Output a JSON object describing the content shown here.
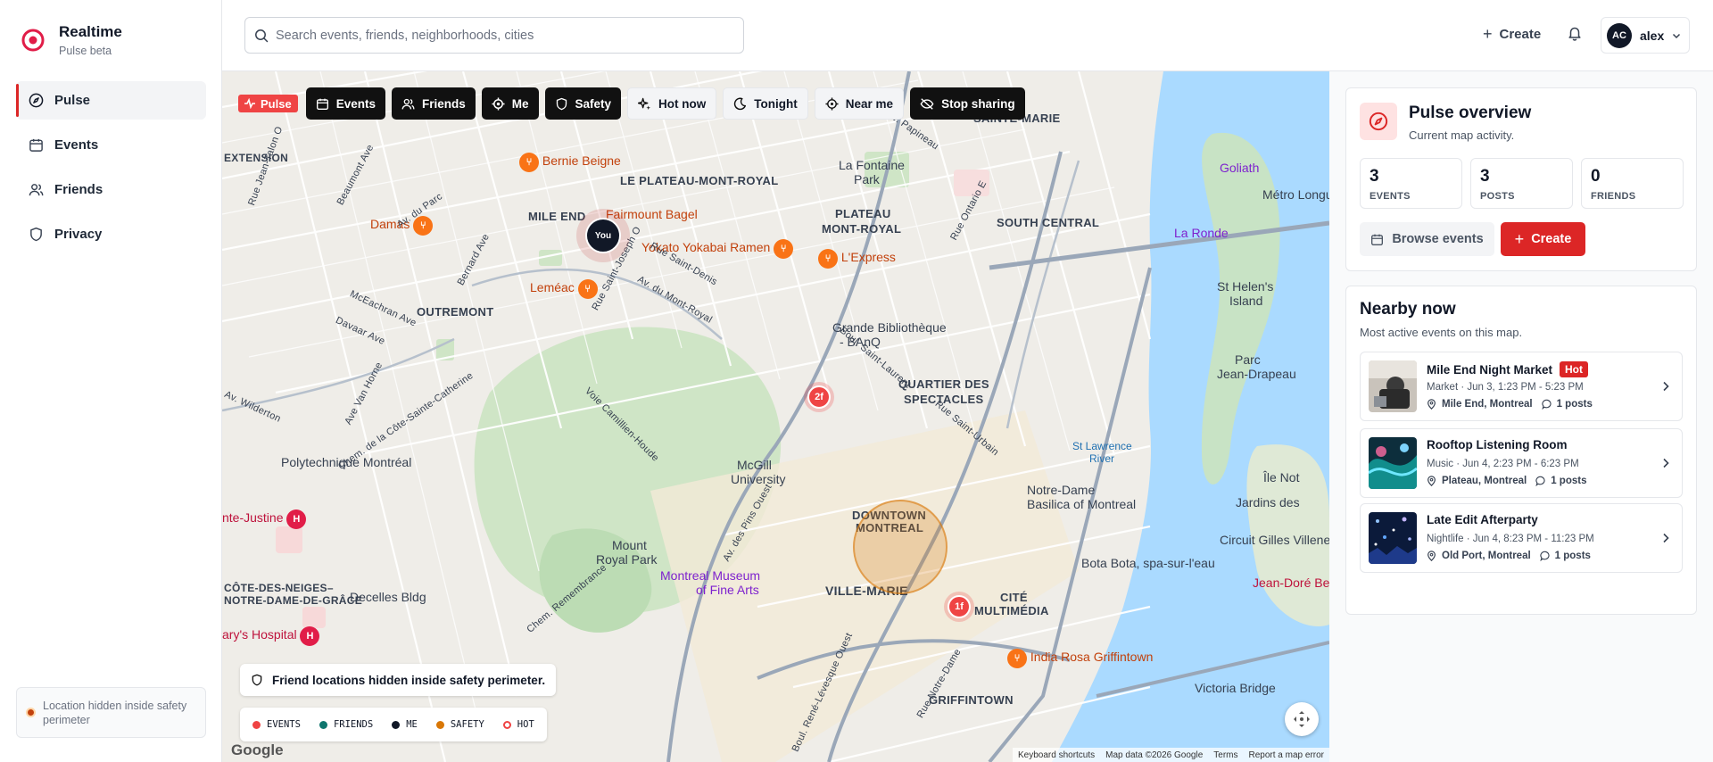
{
  "brand": {
    "name": "Realtime",
    "subtitle": "Pulse beta"
  },
  "sidebar": {
    "items": [
      {
        "label": "Pulse",
        "icon": "compass-icon",
        "active": true
      },
      {
        "label": "Events",
        "icon": "calendar-icon",
        "active": false
      },
      {
        "label": "Friends",
        "icon": "users-icon",
        "active": false
      },
      {
        "label": "Privacy",
        "icon": "shield-icon",
        "active": false
      }
    ],
    "footer": "Location hidden inside safety perimeter"
  },
  "header": {
    "search_placeholder": "Search events, friends, neighborhoods, cities",
    "create_label": "Create",
    "user": {
      "initials": "AC",
      "name": "alex"
    }
  },
  "map": {
    "pulse_badge": "Pulse",
    "filters": [
      {
        "label": "Events",
        "icon": "calendar-icon",
        "style": "dark"
      },
      {
        "label": "Friends",
        "icon": "users-icon",
        "style": "dark"
      },
      {
        "label": "Me",
        "icon": "target-icon",
        "style": "dark"
      },
      {
        "label": "Safety",
        "icon": "shield-icon",
        "style": "dark"
      },
      {
        "label": "Hot now",
        "icon": "sparkle-icon",
        "style": "light"
      },
      {
        "label": "Tonight",
        "icon": "moon-icon",
        "style": "light"
      },
      {
        "label": "Near me",
        "icon": "crosshair-icon",
        "style": "light"
      },
      {
        "label": "Stop sharing",
        "icon": "eye-off-icon",
        "style": "dark"
      }
    ],
    "you_label": "You",
    "clusters": [
      "2f",
      "1f"
    ],
    "notice": "Friend locations hidden inside safety perimeter.",
    "legend": [
      {
        "label": "EVENTS",
        "color": "#ef4444"
      },
      {
        "label": "FRIENDS",
        "color": "#0f766e"
      },
      {
        "label": "ME",
        "color": "#111827"
      },
      {
        "label": "SAFETY",
        "color": "#d97706"
      },
      {
        "label": "HOT",
        "color": "#ef4444"
      }
    ],
    "google": "Google",
    "attribution": [
      "Keyboard shortcuts",
      "Map data ©2026 Google",
      "Terms",
      "Report a map error"
    ],
    "districts": [
      "LE PLATEAU-MONT-ROYAL",
      "MILE END",
      "PLATEAU",
      "MONT-ROYAL",
      "SAINTE-MARIE",
      "SOUTH CENTRAL",
      "OUTREMONT",
      "QUARTIER DES",
      "SPECTACLES",
      "DOWNTOWN",
      "MONTREAL",
      "VILLE-MARIE",
      "CITÉ",
      "MULTIMÉDIA",
      "GRIFFINTOWN",
      "CÔTE-DES-NEIGES–",
      "NOTRE-DAME-DE-GRÂCE",
      "EXTENSION"
    ],
    "places": [
      "Bernie Beigne",
      "Fairmount Bagel",
      "Yokato Yokabai Ramen",
      "L'Express",
      "Damas",
      "Leméac",
      "La Fontaine",
      "Park",
      "Grande Bibliothèque",
      "- BAnQ",
      "McGill",
      "University",
      "Mount",
      "Royal Park",
      "Montreal Museum",
      "of Fine Arts",
      "Polytechnique Montréal",
      "nte-Justine",
      "Decelles Bldg",
      "ary's Hospital",
      "Notre-Dame",
      "Basilica of Montreal",
      "Bota Bota, spa-sur-l'eau",
      "India Rosa Griffintown",
      "Victoria Bridge",
      "Goliath",
      "La Ronde",
      "Métro Longu",
      "St Helen's",
      "Island",
      "Parc",
      "Jean-Drapeau",
      "Jardins des",
      "Circuit Gilles Villene",
      "Jean-Doré Be",
      "Île Not",
      "St Lawrence",
      "River"
    ],
    "streets": [
      "Av. du Parc",
      "Rue Saint-Urbain",
      "Boul. Saint-Laurent",
      "Rue Jean-Talon O",
      "Beaumont Ave",
      "Bernard Ave",
      "McEachran Ave",
      "Davaar Ave",
      "Ave Van Horne",
      "Av. Wilderton",
      "Chem. de la Côte-Sainte-Catherine",
      "Voie Camillien-Houde",
      "Chem. Remembrance",
      "Av. des Pins Ouest",
      "Rue Saint-Joseph O",
      "Av. du Mont-Royal",
      "Rue Saint-Denis",
      "Boul. René-Lévesque Ouest",
      "Rue Notre-Dame",
      "Rue Ontario E",
      "Av. Papineau"
    ]
  },
  "overview": {
    "title": "Pulse overview",
    "subtitle": "Current map activity.",
    "stats": [
      {
        "value": "3",
        "label": "EVENTS"
      },
      {
        "value": "3",
        "label": "POSTS"
      },
      {
        "value": "0",
        "label": "FRIENDS"
      }
    ],
    "browse_label": "Browse events",
    "create_label": "Create"
  },
  "nearby": {
    "title": "Nearby now",
    "subtitle": "Most active events on this map.",
    "events": [
      {
        "title": "Mile End Night Market",
        "hot": "Hot",
        "meta": "Market · Jun 3, 1:23 PM - 5:23 PM",
        "location": "Mile End, Montreal",
        "posts": "1 posts"
      },
      {
        "title": "Rooftop Listening Room",
        "hot": "",
        "meta": "Music · Jun 4, 2:23 PM - 6:23 PM",
        "location": "Plateau, Montreal",
        "posts": "1 posts"
      },
      {
        "title": "Late Edit Afterparty",
        "hot": "",
        "meta": "Nightlife · Jun 4, 8:23 PM - 11:23 PM",
        "location": "Old Port, Montreal",
        "posts": "1 posts"
      }
    ]
  },
  "colors": {
    "accent": "#dc2626",
    "dark_chip": "#111111",
    "water": "#aadaff",
    "park": "#c8e6c9"
  }
}
